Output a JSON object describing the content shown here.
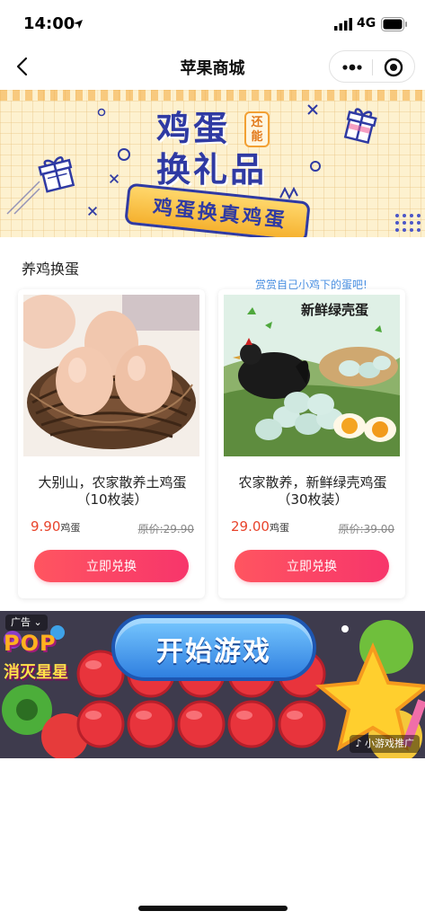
{
  "status_bar": {
    "time": "14:00",
    "network": "4G"
  },
  "nav": {
    "title": "苹果商城"
  },
  "banner": {
    "headline_line1": "鸡蛋",
    "headline_line2": "换礼品",
    "badge": "还能",
    "subtitle": "鸡蛋换真鸡蛋"
  },
  "section": {
    "title": "养鸡换蛋",
    "marquee": "赏赏自己小鸡下的蛋吧!"
  },
  "products": [
    {
      "name": "大别山，农家散养土鸡蛋（10枚装）",
      "price": "9.90",
      "price_unit": "鸡蛋",
      "original_price": "原价:29.90",
      "button": "立即兑换"
    },
    {
      "name": "农家散养，新鲜绿壳鸡蛋（30枚装）",
      "price": "29.00",
      "price_unit": "鸡蛋",
      "original_price": "原价:39.00",
      "button": "立即兑换",
      "image_text": "新鲜绿壳蛋"
    }
  ],
  "ad": {
    "tag": "广告",
    "start_label": "开始游戏",
    "game_title": "POP",
    "game_subtitle": "消灭星星",
    "promo": "小游戏推广"
  },
  "colors": {
    "price": "#e8442c",
    "button_gradient_start": "#ff5560",
    "button_gradient_end": "#f7356b",
    "banner_text": "#2f3aa3",
    "banner_bg": "#fdf1cf"
  }
}
